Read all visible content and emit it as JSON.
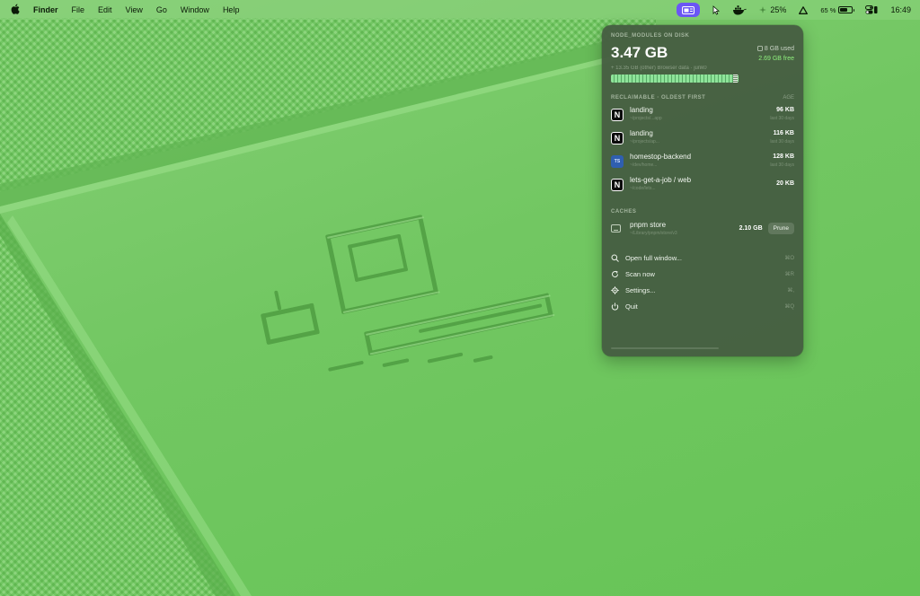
{
  "menubar": {
    "app_name": "Finder",
    "menus": [
      "File",
      "Edit",
      "View",
      "Go",
      "Window",
      "Help"
    ],
    "battery_percent_label": "65 %",
    "battery_level": 0.65,
    "cpu_label": "25%",
    "time": "16:49"
  },
  "panel": {
    "disk_label": "NODE_MODULES ON DISK",
    "disk_total": "3.47 GB",
    "disk_used": "8 GB used",
    "disk_free": "2.69 GB free",
    "disk_subline": "+ 13.35 GB (other) Browser data · junk0",
    "reclaimable_label": "RECLAIMABLE · OLDEST FIRST",
    "reclaimable_sort": "AGE",
    "projects": [
      {
        "icon": "N",
        "icon_type": "n",
        "name": "landing",
        "path": "~/projects/...app",
        "size": "96 KB",
        "age": "last 30 days"
      },
      {
        "icon": "N",
        "icon_type": "n",
        "name": "landing",
        "path": "~/projects/ap...",
        "size": "116 KB",
        "age": "last 30 days"
      },
      {
        "icon": "TS",
        "icon_type": "ts",
        "name": "homestop-backend",
        "path": "~/dev/home...",
        "size": "128 KB",
        "age": "last 30 days"
      },
      {
        "icon": "N",
        "icon_type": "n",
        "name": "lets-get-a-job / web",
        "path": "~/code/lets...",
        "size": "20 KB",
        "age": ""
      }
    ],
    "caches_label": "CACHES",
    "cache": {
      "name": "pnpm store",
      "path": "~/Library/pnpm/store/v3",
      "size": "2.10 GB",
      "button": "Prune"
    },
    "menu": [
      {
        "icon": "search-icon",
        "label": "Open full window...",
        "shortcut": "⌘O"
      },
      {
        "icon": "refresh-icon",
        "label": "Scan now",
        "shortcut": "⌘R"
      },
      {
        "icon": "gear-icon",
        "label": "Settings...",
        "shortcut": "⌘,"
      },
      {
        "icon": "power-icon",
        "label": "Quit",
        "shortcut": "⌘Q"
      }
    ]
  },
  "colors": {
    "wallpaper": "#6fc65f",
    "panel_bg": "#465e42",
    "free_text": "#8ff07e",
    "active_tray": "#6b56f5"
  }
}
